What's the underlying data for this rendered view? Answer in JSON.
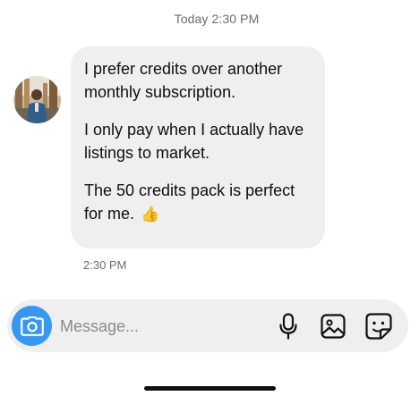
{
  "thread": {
    "date_stamp": "Today 2:30 PM"
  },
  "message": {
    "paragraphs": [
      "I prefer credits over another monthly subscription.",
      "I only pay when I actually have listings to market.",
      "The 50 credits pack is perfect for me."
    ],
    "emoji": "👍",
    "time": "2:30 PM"
  },
  "composer": {
    "placeholder": "Message...",
    "camera_icon": "camera-icon",
    "mic_icon": "microphone-icon",
    "gallery_icon": "image-icon",
    "sticker_icon": "sticker-icon"
  },
  "colors": {
    "accent": "#3897f0",
    "bubble": "#efefef",
    "meta_text": "#6b6b6b"
  }
}
